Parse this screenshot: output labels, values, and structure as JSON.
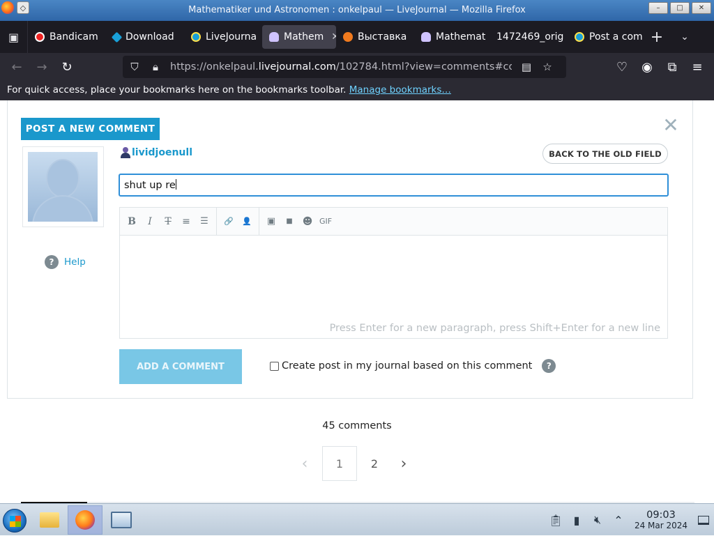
{
  "window": {
    "title": "Mathematiker und Astronomen : onkelpaul — LiveJournal — Mozilla Firefox",
    "controls": [
      "–",
      "□",
      "✕"
    ]
  },
  "tabs": [
    {
      "label": "Bandicam",
      "favicon": "record-icon",
      "active": false
    },
    {
      "label": "Download",
      "favicon": "download-icon",
      "active": false
    },
    {
      "label": "LiveJourna",
      "favicon": "livejournal-icon",
      "active": false
    },
    {
      "label": "Mathem",
      "favicon": "person-icon",
      "active": true
    },
    {
      "label": "Выставка",
      "favicon": "orange-icon",
      "active": false
    },
    {
      "label": "Mathemat",
      "favicon": "person-icon",
      "active": false
    },
    {
      "label": "1472469_orig",
      "favicon": "",
      "active": false
    },
    {
      "label": "Post a com",
      "favicon": "livejournal-icon",
      "active": false
    }
  ],
  "nav": {
    "url_prefix": "https://onkelpaul.",
    "url_domain": "livejournal.com",
    "url_suffix": "/102784.html?view=comments#co"
  },
  "bookmarks": {
    "text": "For quick access, place your bookmarks here on the bookmarks toolbar.",
    "link": "Manage bookmarks…"
  },
  "comment_form": {
    "post_new_label": "POST A NEW COMMENT",
    "close_glyph": "✕",
    "username": "lividjoenull",
    "old_field_label": "BACK TO THE OLD FIELD",
    "subject_value": "shut up re",
    "help_label": "Help",
    "editor_hint": "Press Enter for a new paragraph, press Shift+Enter for a new line",
    "toolbar": {
      "bold": "B",
      "italic": "I",
      "strike": "T",
      "ordered_list": "≡",
      "bullet_list": "☰",
      "link": "🔗",
      "user": "👤",
      "image": "▣",
      "video": "■",
      "emoji": "☻",
      "gif": "GIF"
    },
    "add_label": "ADD A COMMENT",
    "crosspost_label": "Create post in my journal based on this comment",
    "crosspost_checked": false
  },
  "comments": {
    "count_text": "45 comments",
    "pages": [
      "1",
      "2"
    ],
    "current_page": "1"
  },
  "taskbar": {
    "time": "09:03",
    "date": "24 Mar 2024"
  }
}
